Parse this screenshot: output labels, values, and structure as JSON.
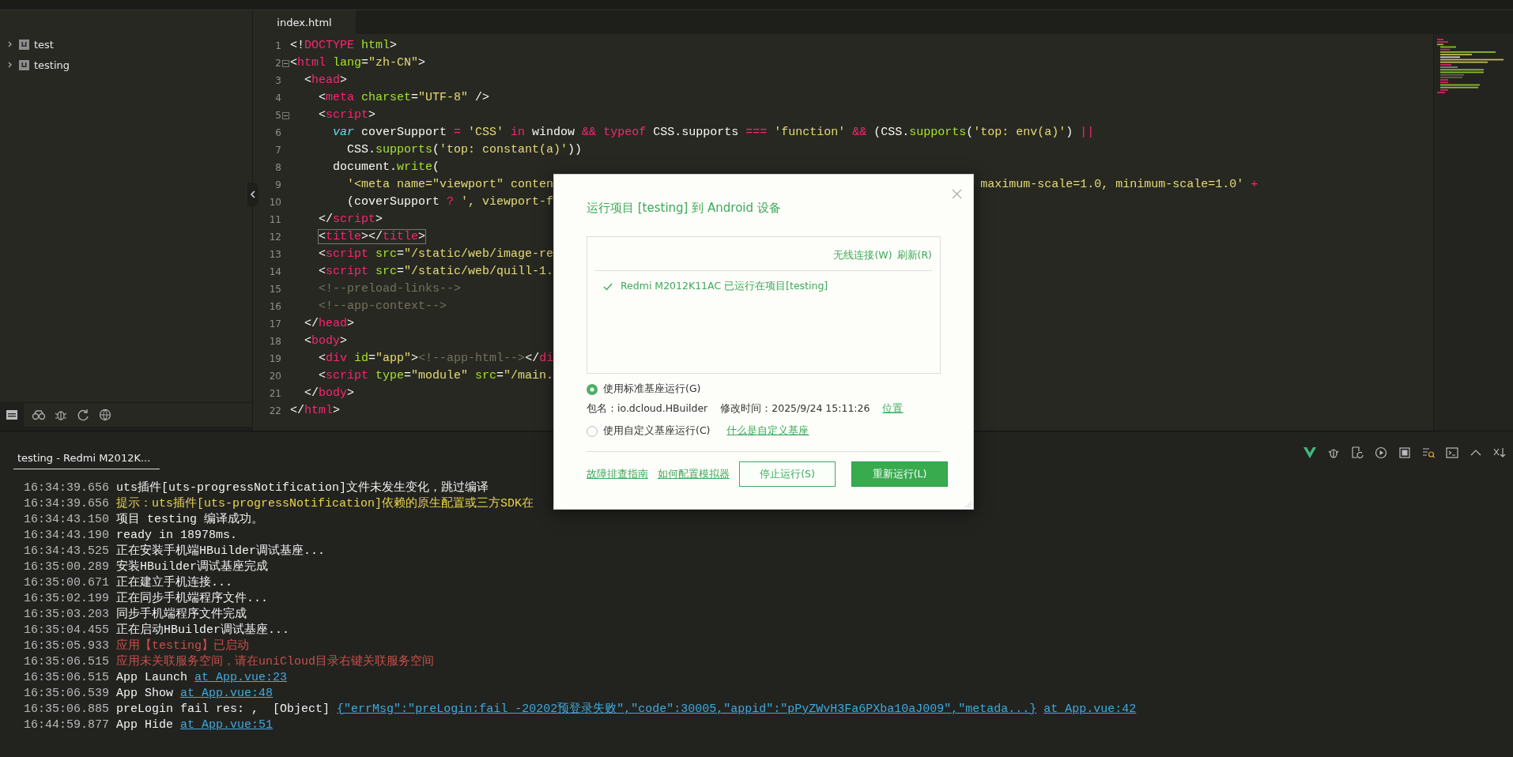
{
  "sidebar": {
    "tree": [
      {
        "label": "test",
        "expanded": false
      },
      {
        "label": "testing",
        "expanded": false
      }
    ]
  },
  "editor": {
    "tabs": [
      {
        "label": "index.html",
        "selected": true
      }
    ],
    "lines": [
      {
        "number": "1",
        "fold": false,
        "tokens": [
          {
            "kind": "plain",
            "text": "<!"
          },
          {
            "kind": "tag",
            "text": "DOCTYPE"
          },
          {
            "kind": "attr",
            "text": " html"
          },
          {
            "kind": "plain",
            "text": ">"
          }
        ]
      },
      {
        "number": "2",
        "fold": true,
        "tokens": [
          {
            "kind": "plain",
            "text": "<"
          },
          {
            "kind": "tag",
            "text": "html"
          },
          {
            "kind": "attr",
            "text": " lang"
          },
          {
            "kind": "plain",
            "text": "="
          },
          {
            "kind": "str",
            "text": "\"zh-CN\""
          },
          {
            "kind": "plain",
            "text": ">"
          }
        ]
      },
      {
        "number": "3",
        "fold": false,
        "tokens": [
          {
            "kind": "plain",
            "text": "  <"
          },
          {
            "kind": "tag",
            "text": "head"
          },
          {
            "kind": "plain",
            "text": ">"
          }
        ]
      },
      {
        "number": "4",
        "fold": false,
        "tokens": [
          {
            "kind": "plain",
            "text": "    <"
          },
          {
            "kind": "tag",
            "text": "meta"
          },
          {
            "kind": "attr",
            "text": " charset"
          },
          {
            "kind": "plain",
            "text": "="
          },
          {
            "kind": "str",
            "text": "\"UTF-8\""
          },
          {
            "kind": "plain",
            "text": " />"
          }
        ]
      },
      {
        "number": "5",
        "fold": true,
        "tokens": [
          {
            "kind": "plain",
            "text": "    <"
          },
          {
            "kind": "tag",
            "text": "script"
          },
          {
            "kind": "plain",
            "text": ">"
          }
        ]
      },
      {
        "number": "6",
        "fold": false,
        "tokens": [
          {
            "kind": "storage",
            "text": "      var"
          },
          {
            "kind": "plain",
            "text": " coverSupport "
          },
          {
            "kind": "op",
            "text": "="
          },
          {
            "kind": "str",
            "text": " 'CSS'"
          },
          {
            "kind": "op",
            "text": " in"
          },
          {
            "kind": "plain",
            "text": " window "
          },
          {
            "kind": "op",
            "text": "&&"
          },
          {
            "kind": "op",
            "text": " typeof"
          },
          {
            "kind": "plain",
            "text": " CSS.supports "
          },
          {
            "kind": "op",
            "text": "==="
          },
          {
            "kind": "str",
            "text": " 'function'"
          },
          {
            "kind": "op",
            "text": " &&"
          },
          {
            "kind": "plain",
            "text": " (CSS."
          },
          {
            "kind": "func",
            "text": "supports"
          },
          {
            "kind": "plain",
            "text": "("
          },
          {
            "kind": "str",
            "text": "'top: env(a)'"
          },
          {
            "kind": "plain",
            "text": ") "
          },
          {
            "kind": "op",
            "text": "||"
          }
        ]
      },
      {
        "number": "7",
        "fold": false,
        "tokens": [
          {
            "kind": "plain",
            "text": "        CSS."
          },
          {
            "kind": "func",
            "text": "supports"
          },
          {
            "kind": "plain",
            "text": "("
          },
          {
            "kind": "str",
            "text": "'top: constant(a)'"
          },
          {
            "kind": "plain",
            "text": "))"
          }
        ]
      },
      {
        "number": "8",
        "fold": false,
        "tokens": [
          {
            "kind": "plain",
            "text": "      document."
          },
          {
            "kind": "func",
            "text": "write"
          },
          {
            "kind": "plain",
            "text": "("
          }
        ]
      },
      {
        "number": "9",
        "fold": false,
        "tokens": [
          {
            "kind": "str",
            "text": "        '<meta name=\"viewport\" conten"
          }
        ],
        "tail": [
          {
            "kind": "str",
            "text": "maximum-scale=1.0, minimum-scale=1.0'"
          },
          {
            "kind": "op",
            "text": " +"
          }
        ]
      },
      {
        "number": "10",
        "fold": false,
        "tokens": [
          {
            "kind": "plain",
            "text": "        (coverSupport "
          },
          {
            "kind": "op",
            "text": "?"
          },
          {
            "kind": "str",
            "text": " ', viewport-f"
          }
        ]
      },
      {
        "number": "11",
        "fold": false,
        "tokens": [
          {
            "kind": "plain",
            "text": "    </"
          },
          {
            "kind": "tag",
            "text": "script"
          },
          {
            "kind": "plain",
            "text": ">"
          }
        ]
      },
      {
        "number": "12",
        "fold": false,
        "matched": true,
        "tokens": [
          {
            "kind": "plain",
            "text": "<"
          },
          {
            "kind": "tag",
            "text": "title"
          },
          {
            "kind": "plain",
            "text": "></"
          },
          {
            "kind": "tag",
            "text": "title"
          },
          {
            "kind": "plain",
            "text": ">"
          }
        ]
      },
      {
        "number": "13",
        "fold": false,
        "tokens": [
          {
            "kind": "plain",
            "text": "    <"
          },
          {
            "kind": "tag",
            "text": "script"
          },
          {
            "kind": "attr",
            "text": " src"
          },
          {
            "kind": "plain",
            "text": "="
          },
          {
            "kind": "str",
            "text": "\"/static/web/image-re"
          }
        ]
      },
      {
        "number": "14",
        "fold": false,
        "tokens": [
          {
            "kind": "plain",
            "text": "    <"
          },
          {
            "kind": "tag",
            "text": "script"
          },
          {
            "kind": "attr",
            "text": " src"
          },
          {
            "kind": "plain",
            "text": "="
          },
          {
            "kind": "str",
            "text": "\"/static/web/quill-1."
          }
        ]
      },
      {
        "number": "15",
        "fold": false,
        "tokens": [
          {
            "kind": "comment",
            "text": "    <!--preload-links-->"
          }
        ]
      },
      {
        "number": "16",
        "fold": false,
        "tokens": [
          {
            "kind": "comment",
            "text": "    <!--app-context-->"
          }
        ]
      },
      {
        "number": "17",
        "fold": false,
        "tokens": [
          {
            "kind": "plain",
            "text": "  </"
          },
          {
            "kind": "tag",
            "text": "head"
          },
          {
            "kind": "plain",
            "text": ">"
          }
        ]
      },
      {
        "number": "18",
        "fold": false,
        "tokens": [
          {
            "kind": "plain",
            "text": "  <"
          },
          {
            "kind": "tag",
            "text": "body"
          },
          {
            "kind": "plain",
            "text": ">"
          }
        ]
      },
      {
        "number": "19",
        "fold": false,
        "tokens": [
          {
            "kind": "plain",
            "text": "    <"
          },
          {
            "kind": "tag",
            "text": "div"
          },
          {
            "kind": "attr",
            "text": " id"
          },
          {
            "kind": "plain",
            "text": "="
          },
          {
            "kind": "str",
            "text": "\"app\""
          },
          {
            "kind": "plain",
            "text": ">"
          },
          {
            "kind": "comment",
            "text": "<!--app-html-->"
          },
          {
            "kind": "plain",
            "text": "</"
          },
          {
            "kind": "tag",
            "text": "di"
          }
        ]
      },
      {
        "number": "20",
        "fold": false,
        "tokens": [
          {
            "kind": "plain",
            "text": "    <"
          },
          {
            "kind": "tag",
            "text": "script"
          },
          {
            "kind": "attr",
            "text": " type"
          },
          {
            "kind": "plain",
            "text": "="
          },
          {
            "kind": "str",
            "text": "\"module\""
          },
          {
            "kind": "attr",
            "text": " src"
          },
          {
            "kind": "plain",
            "text": "="
          },
          {
            "kind": "str",
            "text": "\"/main."
          }
        ]
      },
      {
        "number": "21",
        "fold": false,
        "tokens": [
          {
            "kind": "plain",
            "text": "  </"
          },
          {
            "kind": "tag",
            "text": "body"
          },
          {
            "kind": "plain",
            "text": ">"
          }
        ]
      },
      {
        "number": "22",
        "fold": false,
        "tokens": [
          {
            "kind": "plain",
            "text": "</"
          },
          {
            "kind": "tag",
            "text": "html"
          },
          {
            "kind": "plain",
            "text": ">"
          }
        ]
      }
    ]
  },
  "dialog": {
    "title": "运行项目 [testing] 到 Android 设备",
    "device_actions": [
      "无线连接(W)",
      "刷新(R)"
    ],
    "devices": [
      {
        "name": "Redmi M2012K11AC 已运行在项目[testing]",
        "checked": true
      }
    ],
    "run_options": [
      {
        "label": "使用标准基座运行(G)",
        "selected": true
      },
      {
        "label": "使用自定义基座运行(C)",
        "selected": false,
        "link": "什么是自定义基座"
      }
    ],
    "package_info": {
      "package": "包名：io.dcloud.HBuilder",
      "modified": "修改时间：2025/9/24 15:11:26",
      "link": "位置"
    },
    "footer_links": [
      "故障排查指南",
      "如何配置模拟器"
    ],
    "buttons": [
      {
        "label": "停止运行(S)",
        "kind": "secondary"
      },
      {
        "label": "重新运行(L)",
        "kind": "primary"
      }
    ]
  },
  "console": {
    "tabs": [
      {
        "label": "testing - Redmi M2012K...",
        "selected": true
      }
    ],
    "lines": [
      {
        "time": "16:34:39.656",
        "kind": "normal",
        "parts": [
          {
            "kind": "text",
            "text": "uts插件[uts-progressNotification]文件未发生变化，跳过编译"
          }
        ]
      },
      {
        "time": "16:34:39.656",
        "kind": "warn",
        "parts": [
          {
            "kind": "text",
            "text": "提示：uts插件[uts-progressNotification]依赖的原生配置或三方SDK在"
          }
        ]
      },
      {
        "time": "16:34:43.150",
        "kind": "normal",
        "parts": [
          {
            "kind": "text",
            "text": "项目 testing 编译成功。"
          }
        ]
      },
      {
        "time": "16:34:43.190",
        "kind": "normal",
        "parts": [
          {
            "kind": "text",
            "text": "ready in 18978ms."
          }
        ]
      },
      {
        "time": "16:34:43.525",
        "kind": "normal",
        "parts": [
          {
            "kind": "text",
            "text": "正在安装手机端HBuilder调试基座..."
          }
        ]
      },
      {
        "time": "16:35:00.289",
        "kind": "normal",
        "parts": [
          {
            "kind": "text",
            "text": "安装HBuilder调试基座完成"
          }
        ]
      },
      {
        "time": "16:35:00.671",
        "kind": "normal",
        "parts": [
          {
            "kind": "text",
            "text": "正在建立手机连接..."
          }
        ]
      },
      {
        "time": "16:35:02.199",
        "kind": "normal",
        "parts": [
          {
            "kind": "text",
            "text": "正在同步手机端程序文件..."
          }
        ]
      },
      {
        "time": "16:35:03.203",
        "kind": "normal",
        "parts": [
          {
            "kind": "text",
            "text": "同步手机端程序文件完成"
          }
        ]
      },
      {
        "time": "16:35:04.455",
        "kind": "normal",
        "parts": [
          {
            "kind": "text",
            "text": "正在启动HBuilder调试基座..."
          }
        ]
      },
      {
        "time": "16:35:05.933",
        "kind": "error",
        "parts": [
          {
            "kind": "text",
            "text": "应用【testing】已启动"
          }
        ]
      },
      {
        "time": "16:35:06.515",
        "kind": "error",
        "parts": [
          {
            "kind": "text",
            "text": "应用未关联服务空间，请在uniCloud目录右键关联服务空间"
          }
        ]
      },
      {
        "time": "16:35:06.515",
        "kind": "normal",
        "parts": [
          {
            "kind": "text",
            "text": "App Launch"
          },
          {
            "kind": "link",
            "text": "at App.vue:23"
          }
        ]
      },
      {
        "time": "16:35:06.539",
        "kind": "normal",
        "parts": [
          {
            "kind": "text",
            "text": "App Show"
          },
          {
            "kind": "link",
            "text": "at App.vue:48"
          }
        ]
      },
      {
        "time": "16:35:06.885",
        "kind": "normal",
        "parts": [
          {
            "kind": "text",
            "text": "preLogin fail res: ,  [Object]"
          },
          {
            "kind": "link",
            "text": "{\"errMsg\":\"preLogin:fail -20202预登录失败\",\"code\":30005,\"appid\":\"pPyZWvH3Fa6PXba10aJ009\",\"metada...}"
          },
          {
            "kind": "link",
            "text": "at App.vue:42"
          }
        ]
      },
      {
        "time": "16:44:59.877",
        "kind": "normal",
        "parts": [
          {
            "kind": "text",
            "text": "App Hide"
          },
          {
            "kind": "link",
            "text": "at App.vue:51"
          }
        ]
      }
    ]
  }
}
